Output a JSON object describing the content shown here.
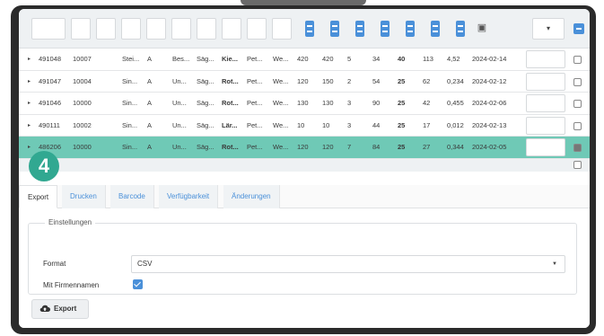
{
  "step_badge": "4",
  "table": {
    "rows": [
      {
        "id": "491048",
        "c2": "10007",
        "c3": "Stei...",
        "c4": "A",
        "c5": "Bes...",
        "c6": "Säg...",
        "c7": "Kie...",
        "c8": "Pet...",
        "c9": "We...",
        "n1": "420",
        "n2": "420",
        "n3": "5",
        "n4": "34",
        "n5": "40",
        "n6": "113",
        "n7": "4,52",
        "date": "2024-02-14",
        "checked": false,
        "selected": false
      },
      {
        "id": "491047",
        "c2": "10004",
        "c3": "Sin...",
        "c4": "A",
        "c5": "Un...",
        "c6": "Säg...",
        "c7": "Rot...",
        "c8": "Pet...",
        "c9": "We...",
        "n1": "120",
        "n2": "150",
        "n3": "2",
        "n4": "54",
        "n5": "25",
        "n6": "62",
        "n7": "0,234",
        "date": "2024-02-12",
        "checked": false,
        "selected": false
      },
      {
        "id": "491046",
        "c2": "10000",
        "c3": "Sin...",
        "c4": "A",
        "c5": "Un...",
        "c6": "Säg...",
        "c7": "Rot...",
        "c8": "Pet...",
        "c9": "We...",
        "n1": "130",
        "n2": "130",
        "n3": "3",
        "n4": "90",
        "n5": "25",
        "n6": "42",
        "n7": "0,455",
        "date": "2024-02-06",
        "checked": false,
        "selected": false
      },
      {
        "id": "490111",
        "c2": "10002",
        "c3": "Sin...",
        "c4": "A",
        "c5": "Un...",
        "c6": "Säg...",
        "c7": "Lär...",
        "c8": "Pet...",
        "c9": "We...",
        "n1": "10",
        "n2": "10",
        "n3": "3",
        "n4": "44",
        "n5": "25",
        "n6": "17",
        "n7": "0,012",
        "date": "2024-02-13",
        "checked": false,
        "selected": false
      },
      {
        "id": "486206",
        "c2": "10000",
        "c3": "Sin...",
        "c4": "A",
        "c5": "Un...",
        "c6": "Säg...",
        "c7": "Rot...",
        "c8": "Pet...",
        "c9": "We...",
        "n1": "120",
        "n2": "120",
        "n3": "7",
        "n4": "84",
        "n5": "25",
        "n6": "27",
        "n7": "0,344",
        "date": "2024-02-05",
        "checked": true,
        "selected": true
      }
    ]
  },
  "tabs": [
    "Export",
    "Drucken",
    "Barcode",
    "Verfügbarkeit",
    "Änderungen"
  ],
  "panel": {
    "legend": "Einstellungen",
    "format_label": "Format",
    "format_value": "CSV",
    "firm_label": "Mit Firmennamen",
    "export_button": "Export"
  },
  "icons": {
    "calendar": "calendar-icon",
    "cloud": "cloud-upload-icon"
  },
  "colors": {
    "accent": "#4a90d9",
    "selected_row": "#6fc9b6",
    "badge": "#31a891"
  }
}
